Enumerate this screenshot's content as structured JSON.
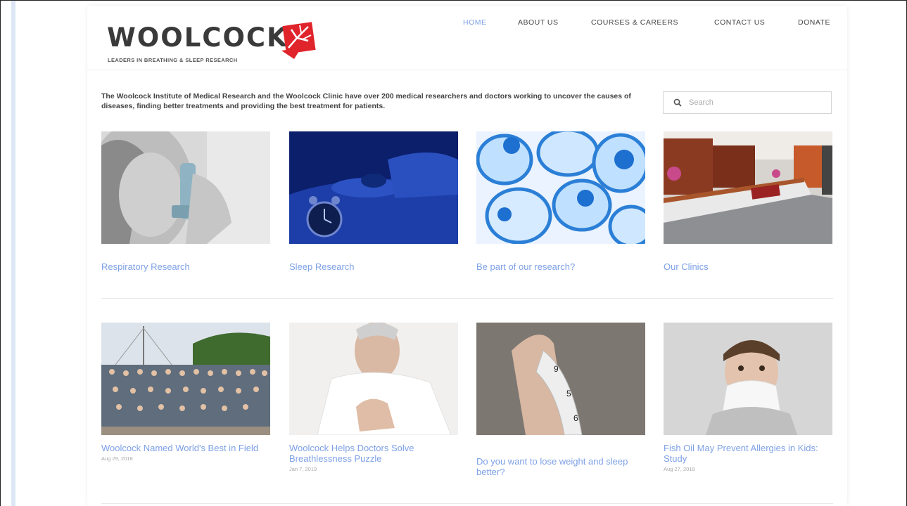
{
  "brand": {
    "name": "WOOLCOCK",
    "tagline": "LEADERS IN BREATHING & SLEEP RESEARCH",
    "accent": "#e0242b"
  },
  "nav": {
    "items": [
      {
        "label": "HOME",
        "active": true
      },
      {
        "label": "ABOUT US",
        "active": false
      },
      {
        "label": "COURSES & CAREERS",
        "active": false
      },
      {
        "label": "CONTACT US",
        "active": false
      },
      {
        "label": "DONATE",
        "active": false
      }
    ],
    "active_color": "#7ea1e6"
  },
  "intro": {
    "text": "The Woolcock Institute of Medical Research and the Woolcock Clinic have over 200 medical researchers and doctors working to uncover the causes of diseases, finding better treatments and providing the best treatment for patients."
  },
  "search": {
    "placeholder": "Search"
  },
  "features": [
    {
      "title": "Respiratory Research",
      "image": "woman-using-inhaler"
    },
    {
      "title": "Sleep Research",
      "image": "person-sleeping-with-alarm-clock"
    },
    {
      "title": "Be part of our research?",
      "image": "blue-cells"
    },
    {
      "title": "Our Clinics",
      "image": "clinic-reception-desk"
    }
  ],
  "news": [
    {
      "title": "Woolcock Named World's Best in Field",
      "date": "Aug 29, 2018",
      "image": "group-photo"
    },
    {
      "title": "Woolcock Helps Doctors Solve Breathlessness Puzzle",
      "date": "Jan 7, 2019",
      "image": "man-hand-on-chest"
    },
    {
      "title": "Do you want to lose weight and sleep better?",
      "date": "",
      "image": "hand-holding-tape-measure"
    },
    {
      "title": "Fish Oil May Prevent Allergies in Kids: Study",
      "date": "Aug 27, 2018",
      "image": "child-blowing-nose"
    }
  ],
  "colors": {
    "link": "#7ea1e6",
    "page_bg": "#ffffff",
    "left_bar": "#dce6f5"
  }
}
